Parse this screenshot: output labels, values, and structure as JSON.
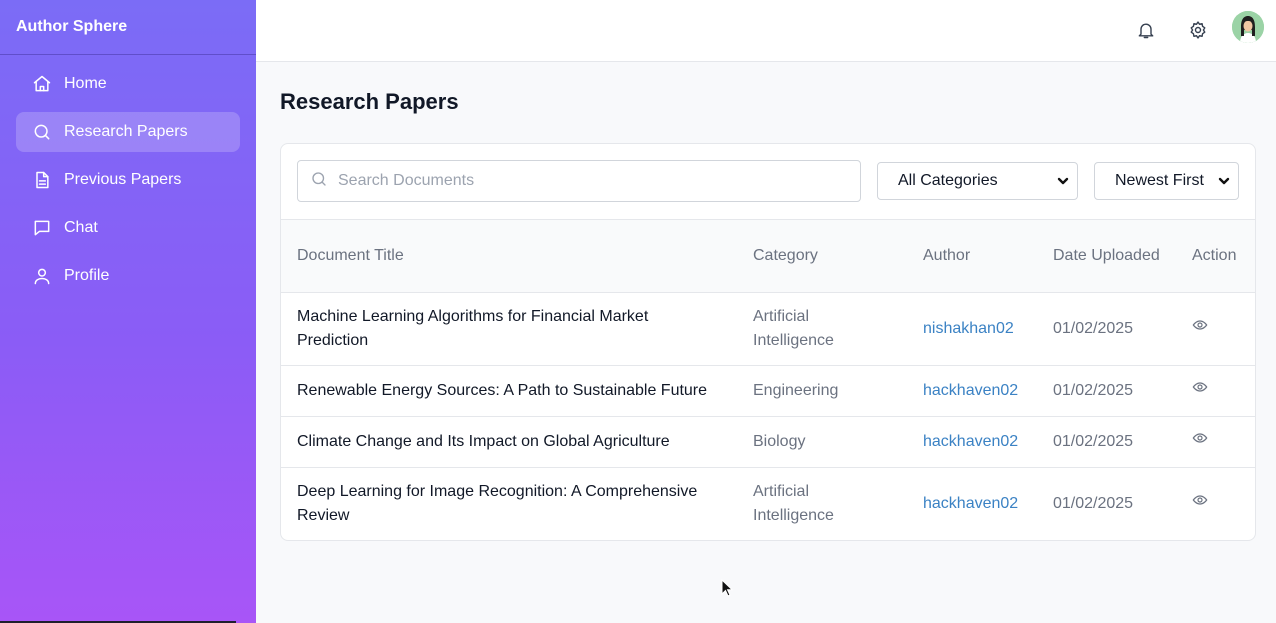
{
  "brand": "Author Sphere",
  "sidebar": {
    "items": [
      {
        "label": "Home",
        "icon": "home-icon"
      },
      {
        "label": "Research Papers",
        "icon": "search-icon",
        "active": true
      },
      {
        "label": "Previous Papers",
        "icon": "document-icon"
      },
      {
        "label": "Chat",
        "icon": "chat-icon"
      },
      {
        "label": "Profile",
        "icon": "user-icon"
      }
    ]
  },
  "topbar": {
    "icons": [
      "bell-icon",
      "gear-icon",
      "avatar"
    ]
  },
  "page": {
    "title": "Research Papers"
  },
  "filters": {
    "search_placeholder": "Search Documents",
    "category": "All Categories",
    "sort": "Newest First"
  },
  "table": {
    "headers": {
      "title": "Document Title",
      "category": "Category",
      "author": "Author",
      "date": "Date Uploaded",
      "action": "Action"
    },
    "rows": [
      {
        "title": "Machine Learning Algorithms for Financial Market Prediction",
        "category": "Artificial Intelligence",
        "author": "nishakhan02",
        "date": "01/02/2025"
      },
      {
        "title": "Renewable Energy Sources: A Path to Sustainable Future",
        "category": "Engineering",
        "author": "hackhaven02",
        "date": "01/02/2025"
      },
      {
        "title": "Climate Change and Its Impact on Global Agriculture",
        "category": "Biology",
        "author": "hackhaven02",
        "date": "01/02/2025"
      },
      {
        "title": "Deep Learning for Image Recognition: A Comprehensive Review",
        "category": "Artificial Intelligence",
        "author": "hackhaven02",
        "date": "01/02/2025"
      }
    ]
  },
  "colors": {
    "sidebar_top": "#7b6cf6",
    "sidebar_bottom": "#a855f7",
    "link": "#3b82c4"
  }
}
